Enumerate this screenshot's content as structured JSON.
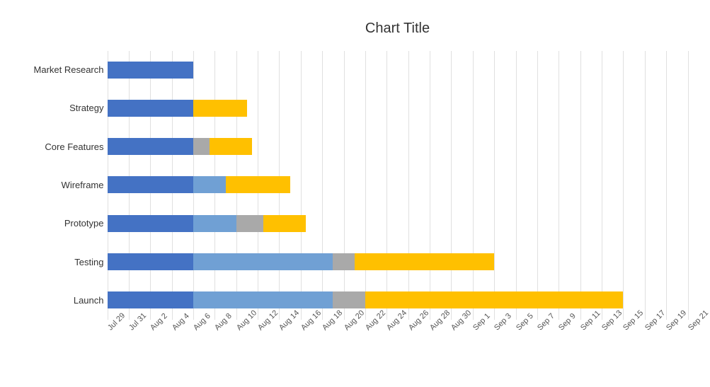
{
  "chart": {
    "title": "Chart Title",
    "colors": {
      "blue_dark": "#4472c4",
      "blue_light": "#70a0d4",
      "gray": "#a9a9a9",
      "yellow": "#ffc000"
    },
    "x_axis": {
      "labels": [
        "Jul 29",
        "Jul 31",
        "Aug 2",
        "Aug 4",
        "Aug 6",
        "Aug 8",
        "Aug 10",
        "Aug 12",
        "Aug 14",
        "Aug 16",
        "Aug 18",
        "Aug 20",
        "Aug 22",
        "Aug 24",
        "Aug 26",
        "Aug 28",
        "Aug 30",
        "Sep 1",
        "Sep 3",
        "Sep 5",
        "Sep 7",
        "Sep 9",
        "Sep 11",
        "Sep 13",
        "Sep 15",
        "Sep 17",
        "Sep 19",
        "Sep 21"
      ],
      "total_days": 54,
      "start_day": 0
    },
    "rows": [
      {
        "label": "Market Research",
        "segments": [
          {
            "type": "blue_dark",
            "start": 0,
            "length": 8
          }
        ]
      },
      {
        "label": "Strategy",
        "segments": [
          {
            "type": "blue_dark",
            "start": 0,
            "length": 8
          },
          {
            "type": "yellow",
            "start": 8,
            "length": 5
          }
        ]
      },
      {
        "label": "Core Features",
        "segments": [
          {
            "type": "blue_dark",
            "start": 0,
            "length": 8
          },
          {
            "type": "gray",
            "start": 8,
            "length": 1.5
          },
          {
            "type": "yellow",
            "start": 9.5,
            "length": 4
          }
        ]
      },
      {
        "label": "Wireframe",
        "segments": [
          {
            "type": "blue_dark",
            "start": 0,
            "length": 8
          },
          {
            "type": "blue_light",
            "start": 8,
            "length": 3
          },
          {
            "type": "yellow",
            "start": 11,
            "length": 6
          }
        ]
      },
      {
        "label": "Prototype",
        "segments": [
          {
            "type": "blue_dark",
            "start": 0,
            "length": 8
          },
          {
            "type": "blue_light",
            "start": 8,
            "length": 4
          },
          {
            "type": "gray",
            "start": 12,
            "length": 2.5
          },
          {
            "type": "yellow",
            "start": 14.5,
            "length": 4
          }
        ]
      },
      {
        "label": "Testing",
        "segments": [
          {
            "type": "blue_dark",
            "start": 0,
            "length": 8
          },
          {
            "type": "blue_light",
            "start": 8,
            "length": 13
          },
          {
            "type": "gray",
            "start": 21,
            "length": 2
          },
          {
            "type": "yellow",
            "start": 23,
            "length": 13
          }
        ]
      },
      {
        "label": "Launch",
        "segments": [
          {
            "type": "blue_dark",
            "start": 0,
            "length": 8
          },
          {
            "type": "blue_light",
            "start": 8,
            "length": 13
          },
          {
            "type": "gray",
            "start": 21,
            "length": 3
          },
          {
            "type": "yellow",
            "start": 24,
            "length": 24
          }
        ]
      }
    ]
  }
}
